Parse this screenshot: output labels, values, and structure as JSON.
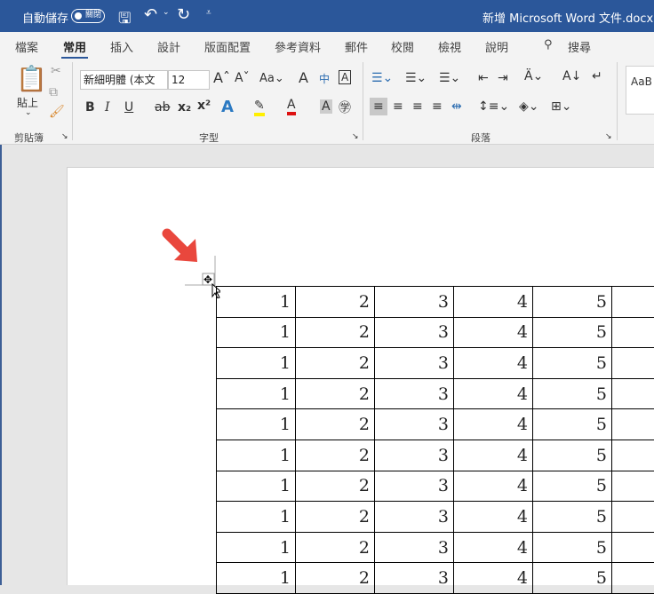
{
  "titlebar": {
    "autosave_label": "自動儲存",
    "autosave_state": "關閉",
    "doc_title": "新增 Microsoft Word 文件.docx",
    "accent": "#2b579a"
  },
  "tabs": [
    "檔案",
    "常用",
    "插入",
    "設計",
    "版面配置",
    "參考資料",
    "郵件",
    "校閱",
    "檢視",
    "說明"
  ],
  "active_tab": "常用",
  "search_label": "搜尋",
  "ribbon": {
    "clipboard": {
      "paste_label": "貼上",
      "group_label": "剪貼簿"
    },
    "font": {
      "font_name": "新細明體 (本文",
      "font_size": "12",
      "group_label": "字型"
    },
    "paragraph": {
      "group_label": "段落"
    },
    "styles": {
      "preview": "AaB"
    }
  },
  "table": {
    "rows": [
      [
        "1",
        "2",
        "3",
        "4",
        "5"
      ],
      [
        "1",
        "2",
        "3",
        "4",
        "5"
      ],
      [
        "1",
        "2",
        "3",
        "4",
        "5"
      ],
      [
        "1",
        "2",
        "3",
        "4",
        "5"
      ],
      [
        "1",
        "2",
        "3",
        "4",
        "5"
      ],
      [
        "1",
        "2",
        "3",
        "4",
        "5"
      ],
      [
        "1",
        "2",
        "3",
        "4",
        "5"
      ],
      [
        "1",
        "2",
        "3",
        "4",
        "5"
      ],
      [
        "1",
        "2",
        "3",
        "4",
        "5"
      ],
      [
        "1",
        "2",
        "3",
        "4",
        "5"
      ]
    ]
  }
}
